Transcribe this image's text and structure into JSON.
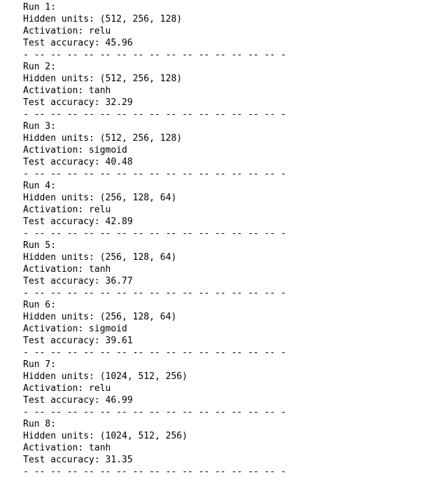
{
  "runs": [
    {
      "header": "Run 1:",
      "hidden": "Hidden units: (512, 256, 128)",
      "activation": "Activation: relu",
      "accuracy": "Test accuracy: 45.96"
    },
    {
      "header": "Run 2:",
      "hidden": "Hidden units: (512, 256, 128)",
      "activation": "Activation: tanh",
      "accuracy": "Test accuracy: 32.29"
    },
    {
      "header": "Run 3:",
      "hidden": "Hidden units: (512, 256, 128)",
      "activation": "Activation: sigmoid",
      "accuracy": "Test accuracy: 40.48"
    },
    {
      "header": "Run 4:",
      "hidden": "Hidden units: (256, 128, 64)",
      "activation": "Activation: relu",
      "accuracy": "Test accuracy: 42.89"
    },
    {
      "header": "Run 5:",
      "hidden": "Hidden units: (256, 128, 64)",
      "activation": "Activation: tanh",
      "accuracy": "Test accuracy: 36.77"
    },
    {
      "header": "Run 6:",
      "hidden": "Hidden units: (256, 128, 64)",
      "activation": "Activation: sigmoid",
      "accuracy": "Test accuracy: 39.61"
    },
    {
      "header": "Run 7:",
      "hidden": "Hidden units: (1024, 512, 256)",
      "activation": "Activation: relu",
      "accuracy": "Test accuracy: 46.99"
    },
    {
      "header": "Run 8:",
      "hidden": "Hidden units: (1024, 512, 256)",
      "activation": "Activation: tanh",
      "accuracy": "Test accuracy: 31.35"
    }
  ],
  "separator": "- -- -- -- -- -- -- -- -- -- -- -- -- -- -- -- -"
}
